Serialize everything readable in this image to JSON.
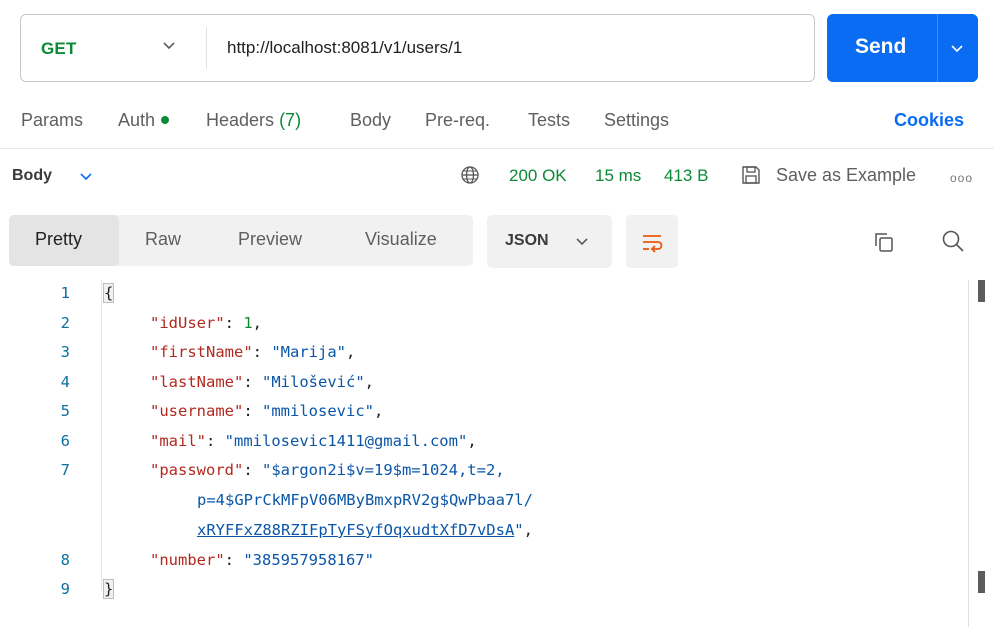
{
  "request": {
    "method": "GET",
    "url": "http://localhost:8081/v1/users/1",
    "send_label": "Send"
  },
  "request_tabs": {
    "params": "Params",
    "auth": "Auth",
    "headers": "Headers",
    "headers_count": "(7)",
    "body": "Body",
    "prereq": "Pre-req.",
    "tests": "Tests",
    "settings": "Settings",
    "cookies": "Cookies"
  },
  "response": {
    "body_label": "Body",
    "status": "200 OK",
    "time": "15 ms",
    "size": "413 B",
    "save_example": "Save as Example",
    "more": "ooo"
  },
  "view_tabs": {
    "pretty": "Pretty",
    "raw": "Raw",
    "preview": "Preview",
    "visualize": "Visualize",
    "format": "JSON"
  },
  "code": {
    "line_numbers": [
      "1",
      "2",
      "3",
      "4",
      "5",
      "6",
      "7",
      "8",
      "9"
    ],
    "open_brace": "{",
    "close_brace": "}",
    "k1": "\"idUser\"",
    "v1": "1",
    "k2": "\"firstName\"",
    "v2": "\"Marija\"",
    "k3": "\"lastName\"",
    "v3": "\"Milošević\"",
    "k4": "\"username\"",
    "v4": "\"mmilosevic\"",
    "k5": "\"mail\"",
    "v5": "\"mmilosevic1411@gmail.com\"",
    "k6": "\"password\"",
    "v6a": "\"$argon2i$v=19$m=1024,t=2,",
    "v6b": "p=4$GPrCkMFpV06MByBmxpRV2g$QwPbaa7l/",
    "v6c": "xRYFFxZ88RZIFpTyFSyfOqxudtXfD7vDsA",
    "v6d": "\"",
    "k7": "\"number\"",
    "v7": "\"385957958167\"",
    "colon": ": ",
    "comma": ","
  },
  "colors": {
    "accent": "#0a6cf2",
    "method_get": "#0b8a35",
    "json_key": "#b1291f",
    "json_string": "#0b56a8",
    "json_number": "#0b8a35"
  },
  "icons": [
    "chevron-down-icon",
    "globe-icon",
    "save-icon",
    "more-icon",
    "wrap-lines-icon",
    "copy-icon",
    "search-icon"
  ]
}
